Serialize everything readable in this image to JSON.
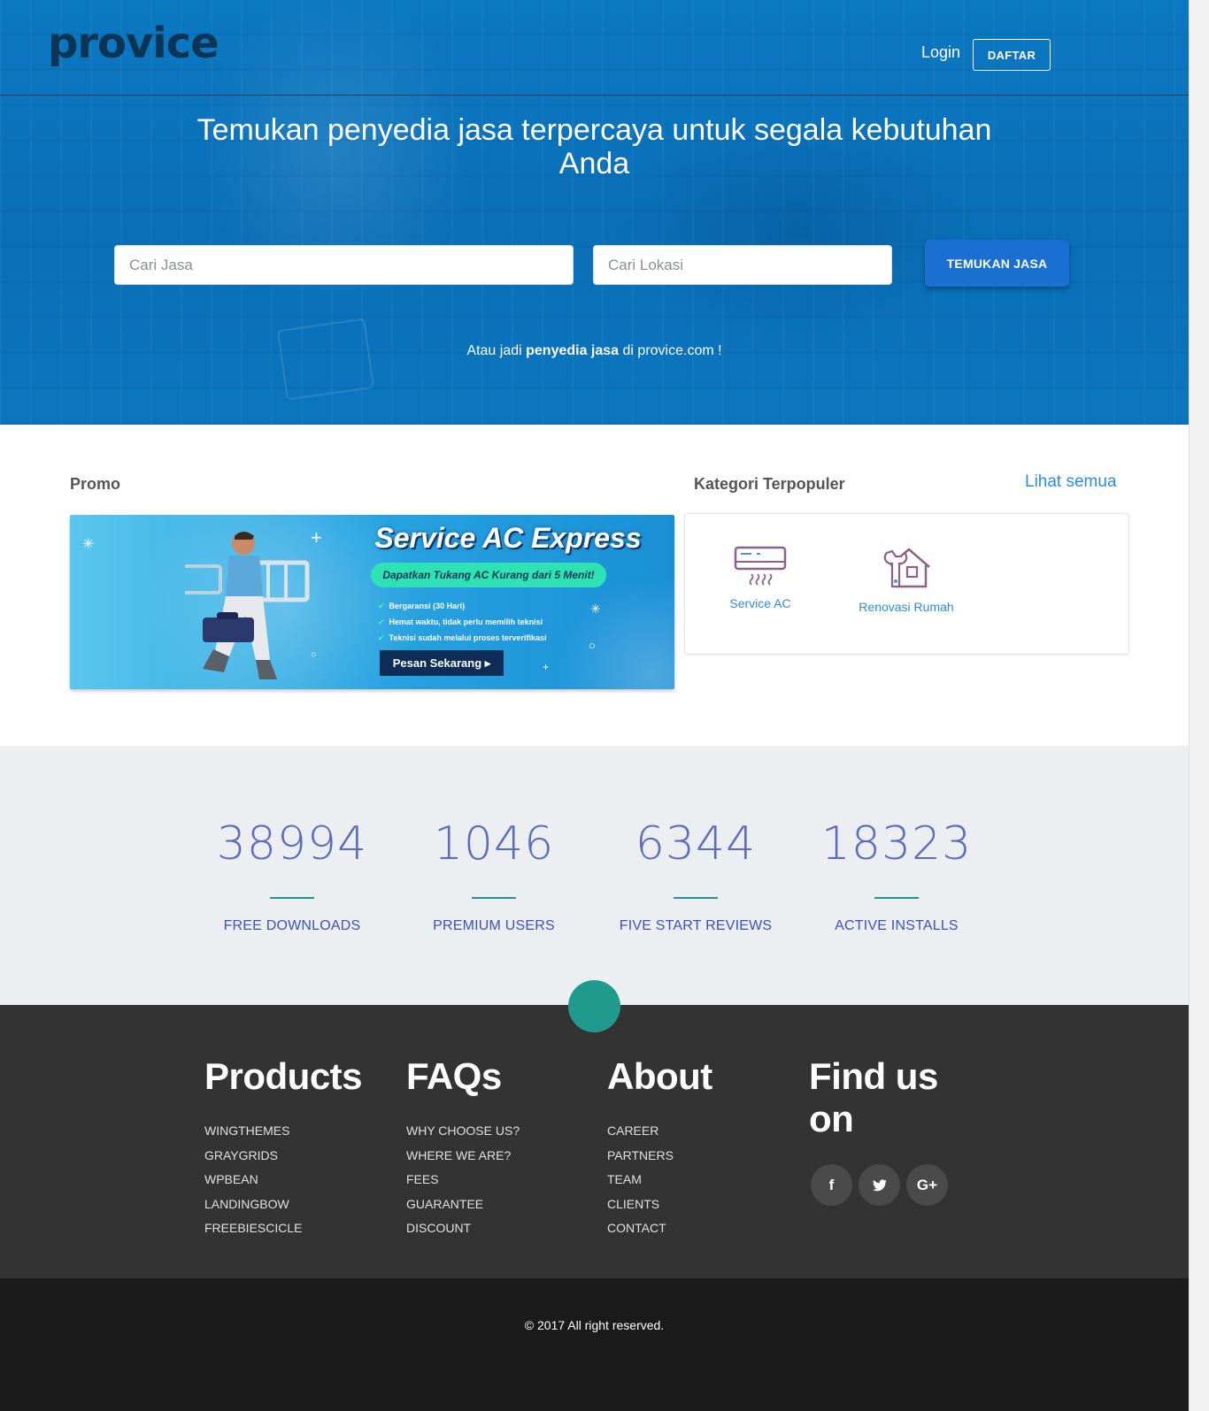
{
  "header": {
    "logo": "provice",
    "login": "Login",
    "register": "DAFTAR"
  },
  "hero": {
    "title": "Temukan penyedia jasa terpercaya untuk segala kebutuhan Anda",
    "search_service_placeholder": "Cari Jasa",
    "search_location_placeholder": "Cari Lokasi",
    "search_button": "TEMUKAN JASA",
    "provider_prefix": "Atau jadi",
    "provider_bold": "penyedia jasa",
    "provider_suffix": "di provice.com !"
  },
  "promo": {
    "heading": "Promo",
    "banner": {
      "title": "Service AC Express",
      "tagline": "Dapatkan Tukang AC Kurang dari 5 Menit!",
      "bullets": [
        "Bergaransi (30 Hari)",
        "Hemat waktu, tidak perlu memilih teknisi",
        "Teknisi sudah melalui proses terverifikasi"
      ],
      "cta": "Pesan Sekarang ▸"
    }
  },
  "kategori": {
    "heading": "Kategori Terpopuler",
    "see_all": "Lihat semua",
    "items": [
      {
        "label": "Service AC",
        "icon": "air-conditioner-icon"
      },
      {
        "label": "Renovasi Rumah",
        "icon": "house-wrench-icon"
      }
    ]
  },
  "stats": [
    {
      "value": "38994",
      "label": "FREE DOWNLOADS"
    },
    {
      "value": "1046",
      "label": "PREMIUM USERS"
    },
    {
      "value": "6344",
      "label": "FIVE START REVIEWS"
    },
    {
      "value": "18323",
      "label": "ACTIVE INSTALLS"
    }
  ],
  "footer": {
    "columns": [
      {
        "title": "Products",
        "links": [
          "WINGTHEMES",
          "GRAYGRIDS",
          "WPBEAN",
          "LANDINGBOW",
          "FREEBIESCICLE"
        ]
      },
      {
        "title": "FAQs",
        "links": [
          "WHY CHOOSE US?",
          "WHERE WE ARE?",
          "FEES",
          "GUARANTEE",
          "DISCOUNT"
        ]
      },
      {
        "title": "About",
        "links": [
          "CAREER",
          "PARTNERS",
          "TEAM",
          "CLIENTS",
          "CONTACT"
        ]
      }
    ],
    "find_us": "Find us on",
    "social": [
      {
        "glyph": "f",
        "icon": "facebook-icon"
      },
      {
        "glyph": "🐦",
        "icon": "twitter-icon"
      },
      {
        "glyph": "G+",
        "icon": "google-plus-icon"
      }
    ],
    "copyright": "© 2017 All right reserved."
  },
  "colors": {
    "hero_blue": "#0a73bc",
    "button_blue": "#1a6fd1",
    "link_blue": "#2a8fd8",
    "stat_indigo": "#5c6bc0",
    "teal": "#1f9a8c",
    "footer_dark": "#333333"
  }
}
